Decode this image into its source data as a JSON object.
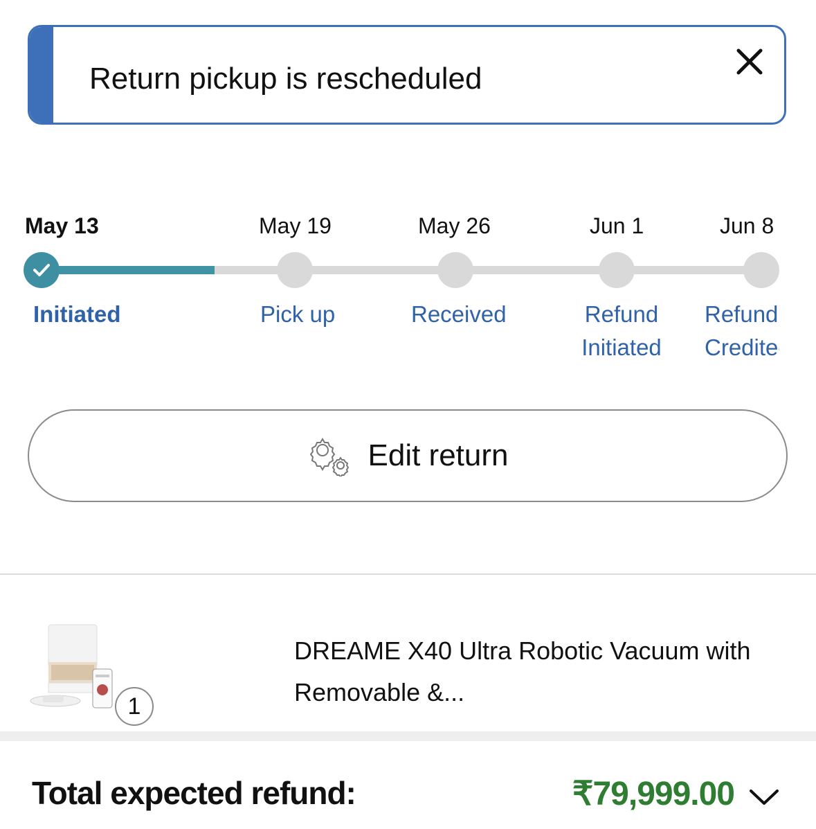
{
  "banner": {
    "message": "Return pickup is rescheduled",
    "close_icon": "close-icon",
    "accent_color": "#3e70ba"
  },
  "timeline": {
    "steps": [
      {
        "date": "May 13",
        "label": "Initiated",
        "status": "done"
      },
      {
        "date": "May 19",
        "label": "Pick up",
        "status": "pending"
      },
      {
        "date": "May 26",
        "label": "Received",
        "status": "pending"
      },
      {
        "date": "Jun 1",
        "label_line1": "Refund",
        "label_line2": "Initiated",
        "status": "pending"
      },
      {
        "date": "Jun 8",
        "label_line1": "Refund",
        "label_line2": "Credited",
        "status": "pending"
      }
    ],
    "progress_color": "#3f93a5"
  },
  "edit_button": {
    "label": "Edit return",
    "icon": "gears-icon"
  },
  "product": {
    "title": "DREAME X40 Ultra Robotic Vacuum with Removable &...",
    "quantity": "1"
  },
  "summary": {
    "total_label": "Total expected refund:",
    "total_amount": "₹79,999.00",
    "amount_color": "#2e7d32",
    "expand_icon": "chevron-down-icon"
  }
}
